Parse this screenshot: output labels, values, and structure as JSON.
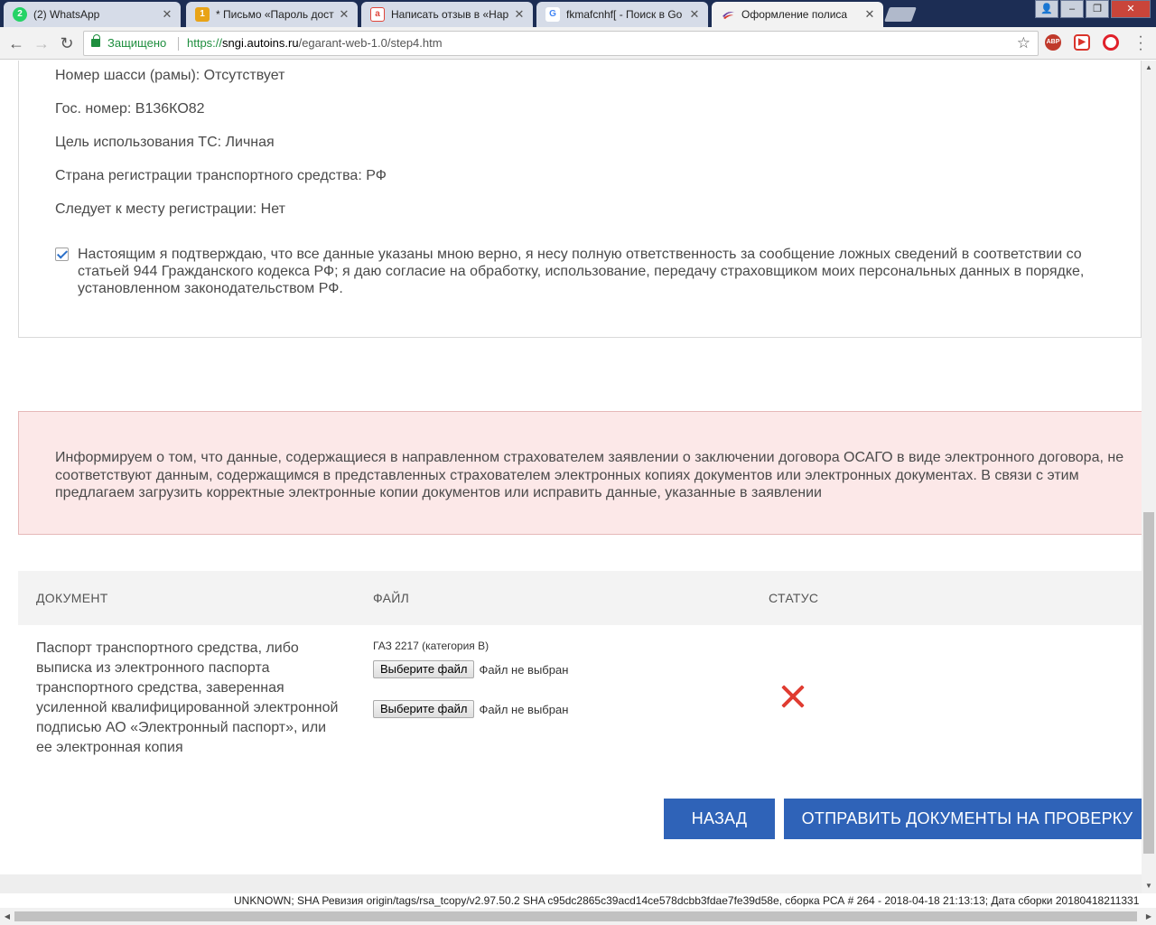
{
  "browser": {
    "tabs": [
      {
        "title": "(2) WhatsApp",
        "icon": "whatsapp-icon",
        "favtext": "2",
        "color": "#25d366"
      },
      {
        "title": "* Письмо «Пароль досту",
        "icon": "mail-icon",
        "favtext": "1",
        "color": "#e8a317"
      },
      {
        "title": "Написать отзыв в «Нар",
        "icon": "irecommend-icon",
        "favtext": "a",
        "color": "#e0453a"
      },
      {
        "title": "fkmafcnhf[ - Поиск в Go",
        "icon": "google-icon",
        "favtext": "G",
        "color": "#4285f4"
      },
      {
        "title": "Оформление полиса",
        "icon": "autoins-icon",
        "favtext": "",
        "color": "#6b3fa0"
      }
    ],
    "address": {
      "secure_label": "Защищено",
      "scheme": "https://",
      "host": "sngi.autoins.ru",
      "path": "/egarant-web-1.0/step4.htm"
    },
    "extensions": [
      "ABP"
    ]
  },
  "vehicle_info": [
    "Номер шасси (рамы): Отсутствует",
    "Гос. номер: В136КО82",
    "Цель использования ТС: Личная",
    "Страна регистрации транспортного средства: РФ",
    "Следует к месту регистрации: Нет"
  ],
  "consent": {
    "checked": true,
    "text": "Настоящим я подтверждаю, что все данные указаны мною верно, я несу полную ответственность за сообщение ложных сведений в соответствии со статьей 944 Гражданского кодекса РФ; я даю согласие на обработку, использование, передачу страховщиком моих персональных данных в порядке, установленном законодательством РФ."
  },
  "alert": {
    "text": "Информируем о том, что данные, содержащиеся в направленном страхователем заявлении о заключении договора ОСАГО в виде электронного договора, не соответствуют данным, содержащимся в представленных страхователем электронных копиях документов или электронных документах. В связи с этим предлагаем загрузить корректные электронные копии документов или исправить данные, указанные в заявлении"
  },
  "documents_table": {
    "headers": {
      "document": "ДОКУМЕНТ",
      "file": "ФАЙЛ",
      "status": "СТАТУС"
    },
    "rows": [
      {
        "document": "Паспорт транспортного средства, либо выписка из электронного паспорта транспортного средства, заверенная усиленной квалифицированной электронной подписью АО «Электронный паспорт», или ее электронная копия",
        "file_caption": "ГАЗ 2217 (категория В)",
        "file_inputs": [
          {
            "button": "Выберите файл",
            "value": "Файл не выбран"
          },
          {
            "button": "Выберите файл",
            "value": "Файл не выбран"
          }
        ],
        "status": "error",
        "status_icon": "cross-icon"
      }
    ]
  },
  "actions": {
    "back": "НАЗАД",
    "submit": "ОТПРАВИТЬ ДОКУМЕНТЫ НА ПРОВЕРКУ"
  },
  "build_info": "UNKNOWN; SHA Ревизия origin/tags/rsa_tcopy/v2.97.50.2 SHA c95dc2865c39acd14ce578dcbb3fdae7fe39d58e, сборка РСА # 264 - 2018-04-18 21:13:13; Дата сборки 20180418211331"
}
